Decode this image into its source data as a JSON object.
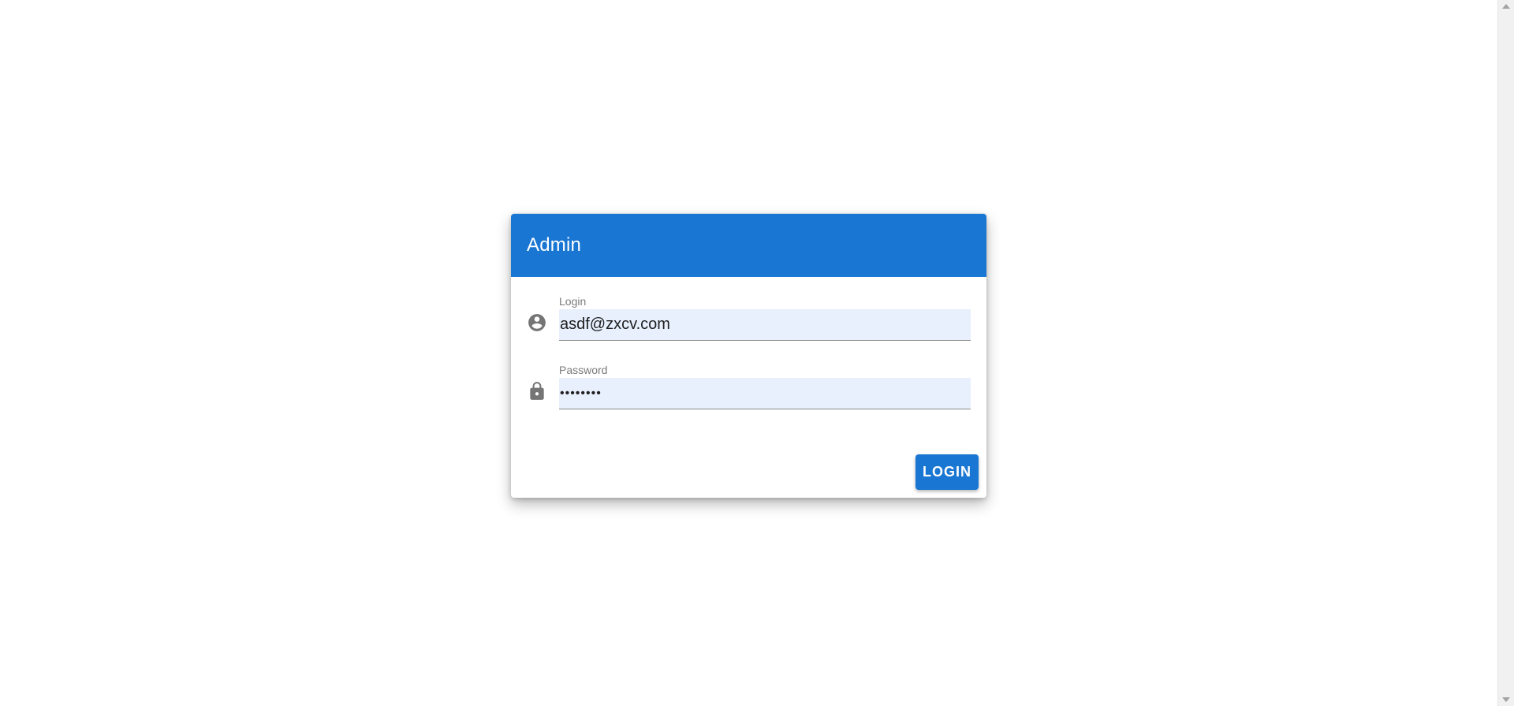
{
  "card": {
    "title": "Admin"
  },
  "login_field": {
    "label": "Login",
    "value": "asdf@zxcv.com",
    "icon": "account-circle-icon"
  },
  "password_field": {
    "label": "Password",
    "value": "••••••••",
    "icon": "lock-icon"
  },
  "actions": {
    "login_label": "LOGIN"
  },
  "colors": {
    "primary": "#1976d2",
    "input_autofill_bg": "#e8f0fe",
    "icon_gray": "#757575"
  }
}
